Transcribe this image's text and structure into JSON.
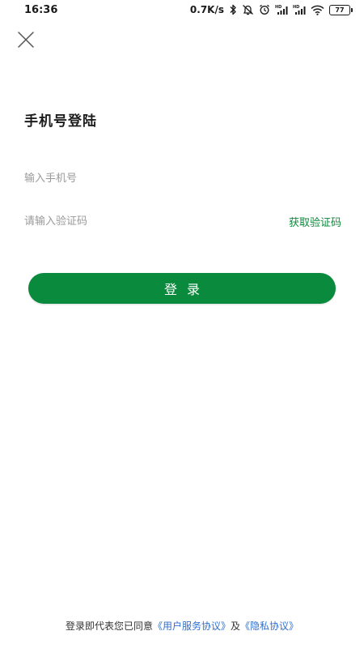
{
  "status_bar": {
    "time": "16:36",
    "network_speed": "0.7K/s",
    "battery_level": "77",
    "icons": [
      "bluetooth-icon",
      "alarm-off-icon",
      "alarm-clock-icon",
      "hd-signal-icon",
      "hd-signal-icon",
      "wifi-icon",
      "battery-icon"
    ]
  },
  "header": {
    "close_icon": "close-icon"
  },
  "login": {
    "title": "手机号登陆",
    "phone_placeholder": "输入手机号",
    "code_placeholder": "请输入验证码",
    "get_code_label": "获取验证码",
    "submit_label": "登录"
  },
  "agreement": {
    "prefix": "登录即代表您已同意",
    "user_agreement": "《用户服务协议》",
    "conjunction": "及",
    "privacy_policy": "《隐私协议》"
  },
  "colors": {
    "primary": "#0a8a3c",
    "link": "#2f6fd0",
    "placeholder": "#9a9a9a"
  }
}
